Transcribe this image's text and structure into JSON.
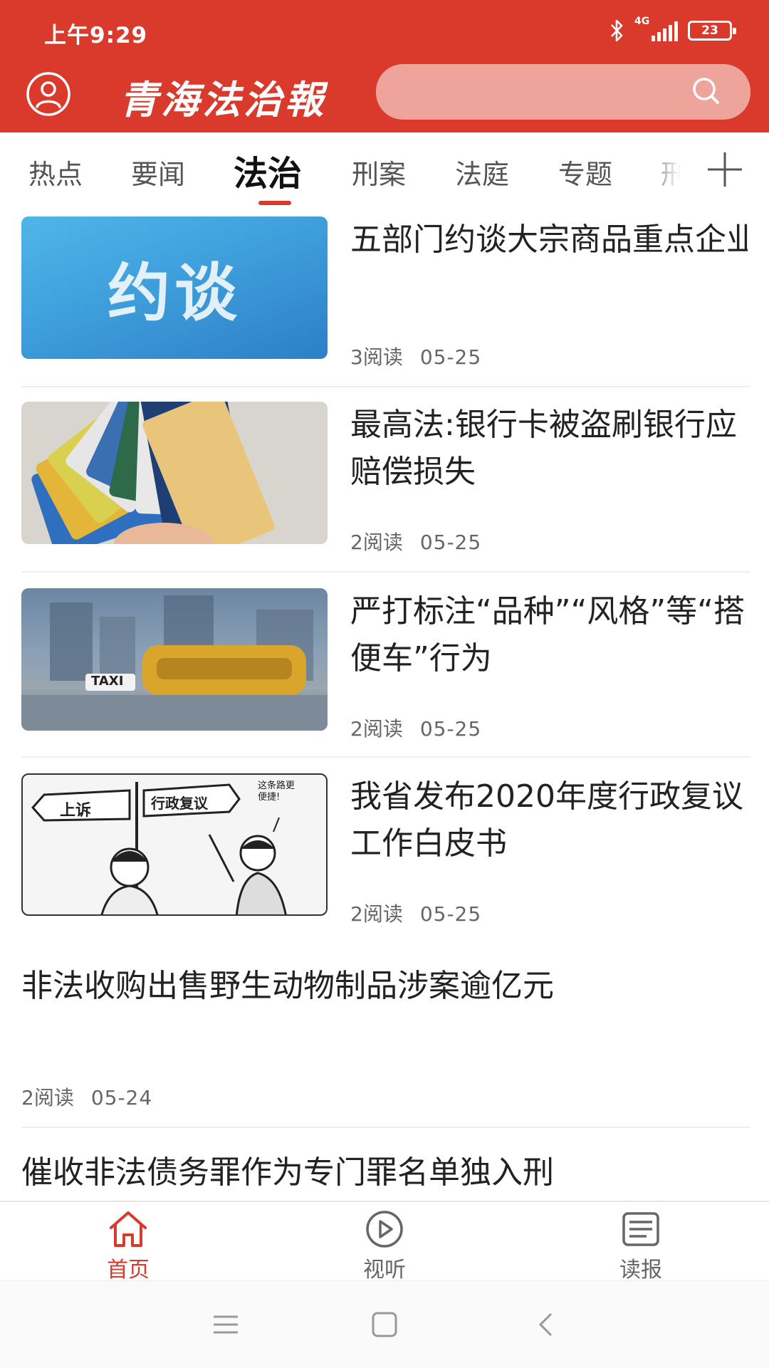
{
  "status_bar": {
    "time": "上午9:29",
    "network": "4G",
    "battery": "23"
  },
  "header": {
    "logo_text": "青海法治報",
    "search_placeholder": "",
    "brand_color": "#d93a2c"
  },
  "tabs": [
    {
      "label": "热点"
    },
    {
      "label": "要闻"
    },
    {
      "label": "法治",
      "active": true
    },
    {
      "label": "刑案"
    },
    {
      "label": "法庭"
    },
    {
      "label": "专题"
    },
    {
      "label": "刑"
    }
  ],
  "news": [
    {
      "title": "五部门约谈大宗商品重点企业:不得囤积居奇...",
      "reads": "3阅读",
      "date": "05-25",
      "thumb_text": "约谈"
    },
    {
      "title": "最高法:银行卡被盗刷银行应赔偿损失",
      "reads": "2阅读",
      "date": "05-25"
    },
    {
      "title": "严打标注“品种”“风格”等“搭便车”行为",
      "reads": "2阅读",
      "date": "05-25",
      "thumb_text": "TAXI"
    },
    {
      "title": "我省发布2020年度行政复议工作白皮书",
      "reads": "2阅读",
      "date": "05-25",
      "thumb_sign_left": "上诉",
      "thumb_sign_right": "行政复议",
      "thumb_bubble": "这条路更便捷!"
    },
    {
      "title": "非法收购出售野生动物制品涉案逾亿元",
      "reads": "2阅读",
      "date": "05-24"
    },
    {
      "title": "催收非法债务罪作为专门罪名单独入刑"
    }
  ],
  "bottom_nav": [
    {
      "label": "首页",
      "icon": "home-icon",
      "active": true
    },
    {
      "label": "视听",
      "icon": "play-circle-icon"
    },
    {
      "label": "读报",
      "icon": "newspaper-icon"
    }
  ]
}
